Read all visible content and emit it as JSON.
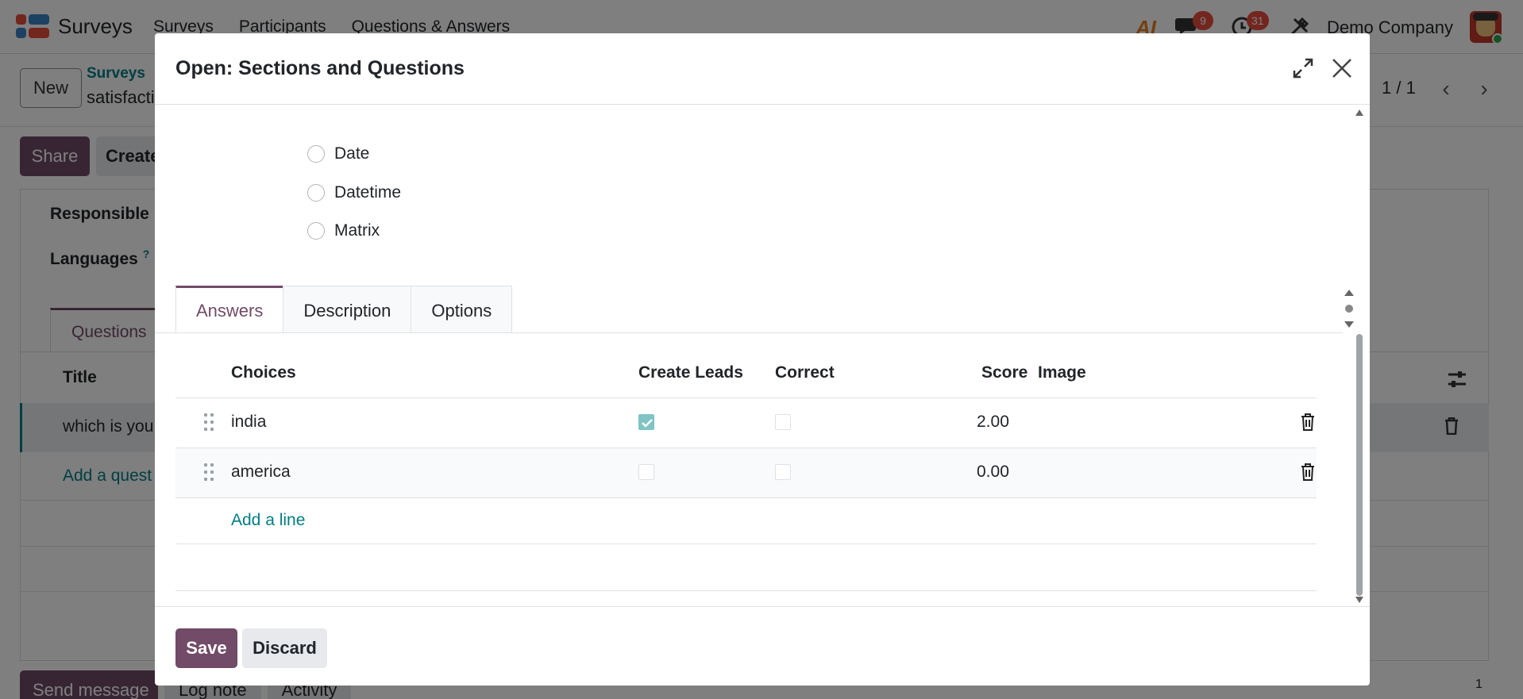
{
  "app": {
    "name": "Surveys",
    "nav": [
      "Surveys",
      "Participants",
      "Questions & Answers"
    ],
    "ai_label": "AI",
    "messages_count": "9",
    "activities_count": "31",
    "company": "Demo Company"
  },
  "control_panel": {
    "new_label": "New",
    "breadcrumb_parent": "Surveys",
    "breadcrumb_current": "satisfacti",
    "pager": "1 / 1"
  },
  "form": {
    "share_label": "Share",
    "create_label": "Create",
    "responsible_label": "Responsible",
    "languages_label": "Languages",
    "languages_help": "?",
    "questions_tab": "Questions",
    "title_header": "Title",
    "question_row": "which is you",
    "add_question": "Add a quest"
  },
  "chatter": {
    "send_message": "Send message",
    "log_note": "Log note",
    "activity": "Activity",
    "followers": "1"
  },
  "modal": {
    "title": "Open: Sections and Questions",
    "question_types": [
      "Date",
      "Datetime",
      "Matrix"
    ],
    "tabs": [
      "Answers",
      "Description",
      "Options"
    ],
    "active_tab": "Answers",
    "columns": {
      "choices": "Choices",
      "create_leads": "Create Leads",
      "correct": "Correct",
      "score": "Score",
      "image": "Image"
    },
    "rows": [
      {
        "choice": "india",
        "create_leads": true,
        "correct": false,
        "score": "2.00"
      },
      {
        "choice": "america",
        "create_leads": false,
        "correct": false,
        "score": "0.00"
      }
    ],
    "add_line": "Add a line",
    "save_label": "Save",
    "discard_label": "Discard"
  },
  "colors": {
    "brand": "#714b67",
    "link": "#017e84",
    "badge": "#e74c3c"
  }
}
